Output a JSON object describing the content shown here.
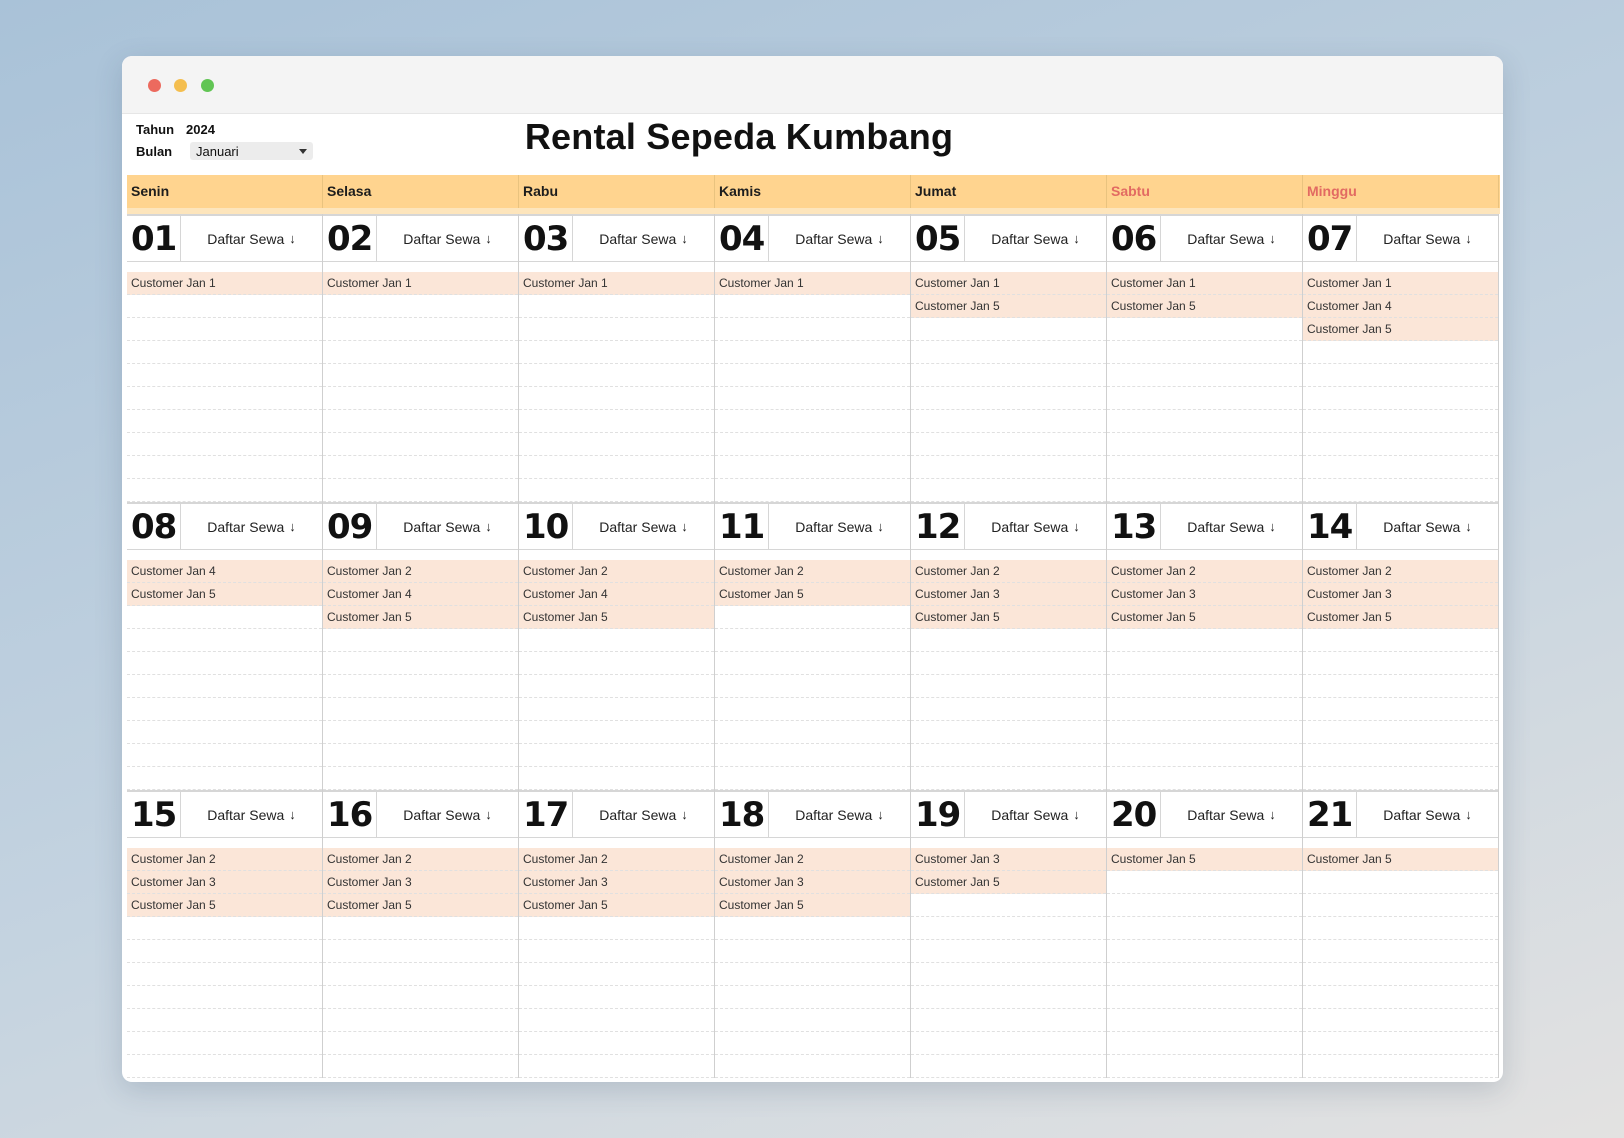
{
  "controls": {
    "year_label": "Tahun",
    "year_value": "2024",
    "month_label": "Bulan",
    "month_value": "Januari"
  },
  "title": "Rental Sepeda Kumbang",
  "weekdays": [
    "Senin",
    "Selasa",
    "Rabu",
    "Kamis",
    "Jumat",
    "Sabtu",
    "Minggu"
  ],
  "weekend_color": "#e26a62",
  "header_color": "#ffd48f",
  "booking_color": "#fbe6d8",
  "list_label": "Daftar Sewa",
  "list_icon": "arrow-down-icon",
  "weeks": [
    [
      {
        "day": "01",
        "customers": [
          "Customer Jan 1"
        ]
      },
      {
        "day": "02",
        "customers": [
          "Customer Jan 1"
        ]
      },
      {
        "day": "03",
        "customers": [
          "Customer Jan 1"
        ]
      },
      {
        "day": "04",
        "customers": [
          "Customer Jan 1"
        ]
      },
      {
        "day": "05",
        "customers": [
          "Customer Jan 1",
          "Customer Jan 5"
        ]
      },
      {
        "day": "06",
        "customers": [
          "Customer Jan 1",
          "Customer Jan 5"
        ]
      },
      {
        "day": "07",
        "customers": [
          "Customer Jan 1",
          "Customer Jan 4",
          "Customer Jan 5"
        ]
      }
    ],
    [
      {
        "day": "08",
        "customers": [
          "Customer Jan 4",
          "Customer Jan 5"
        ]
      },
      {
        "day": "09",
        "customers": [
          "Customer Jan 2",
          "Customer Jan 4",
          "Customer Jan 5"
        ]
      },
      {
        "day": "10",
        "customers": [
          "Customer Jan 2",
          "Customer Jan 4",
          "Customer Jan 5"
        ]
      },
      {
        "day": "11",
        "customers": [
          "Customer Jan 2",
          "Customer Jan 5"
        ]
      },
      {
        "day": "12",
        "customers": [
          "Customer Jan 2",
          "Customer Jan 3",
          "Customer Jan 5"
        ]
      },
      {
        "day": "13",
        "customers": [
          "Customer Jan 2",
          "Customer Jan 3",
          "Customer Jan 5"
        ]
      },
      {
        "day": "14",
        "customers": [
          "Customer Jan 2",
          "Customer Jan 3",
          "Customer Jan 5"
        ]
      }
    ],
    [
      {
        "day": "15",
        "customers": [
          "Customer Jan 2",
          "Customer Jan 3",
          "Customer Jan 5"
        ]
      },
      {
        "day": "16",
        "customers": [
          "Customer Jan 2",
          "Customer Jan 3",
          "Customer Jan 5"
        ]
      },
      {
        "day": "17",
        "customers": [
          "Customer Jan 2",
          "Customer Jan 3",
          "Customer Jan 5"
        ]
      },
      {
        "day": "18",
        "customers": [
          "Customer Jan 2",
          "Customer Jan 3",
          "Customer Jan 5"
        ]
      },
      {
        "day": "19",
        "customers": [
          "Customer Jan 3",
          "Customer Jan 5"
        ]
      },
      {
        "day": "20",
        "customers": [
          "Customer Jan 5"
        ]
      },
      {
        "day": "21",
        "customers": [
          "Customer Jan 5"
        ]
      }
    ]
  ]
}
